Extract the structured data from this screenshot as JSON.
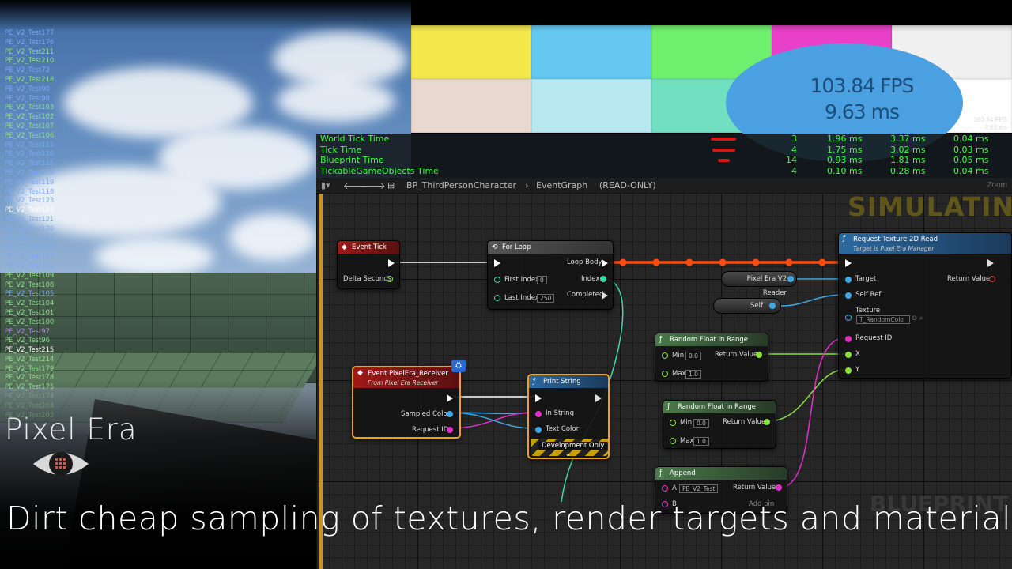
{
  "overlay": {
    "fps_value": "103.84 FPS",
    "frame_ms": "9.63 ms",
    "fps_small": "103.84 FPS",
    "ms_small": "9.63 ms"
  },
  "colors": {
    "board": [
      "#f4e84a",
      "#64c8f0",
      "#6ef06e",
      "#e840c8",
      "#f0f0f0",
      "#e8d8d0",
      "#b8e8f0",
      "#70e0c0",
      "#e8e8e8",
      "#ffffff"
    ],
    "test_green": "#8fe08f",
    "test_blue": "#7aaaf0",
    "test_purple": "#b08ae0",
    "test_white": "#ffffff",
    "accent_orange": "#c9961a",
    "exec_wire": "#ff4a10"
  },
  "tests": [
    {
      "name": "PE_V2_Test177",
      "c": "b"
    },
    {
      "name": "PE_V2_Test176",
      "c": "b"
    },
    {
      "name": "PE_V2_Test211",
      "c": "g"
    },
    {
      "name": "PE_V2_Test210",
      "c": "g"
    },
    {
      "name": "PE_V2_Test72",
      "c": "b"
    },
    {
      "name": "PE_V2_Test218",
      "c": "g"
    },
    {
      "name": "PE_V2_Test90",
      "c": "b"
    },
    {
      "name": "PE_V2_Test98",
      "c": "b"
    },
    {
      "name": "PE_V2_Test103",
      "c": "g"
    },
    {
      "name": "PE_V2_Test102",
      "c": "g"
    },
    {
      "name": "PE_V2_Test107",
      "c": "g"
    },
    {
      "name": "PE_V2_Test106",
      "c": "g"
    },
    {
      "name": "PE_V2_Test111",
      "c": "b"
    },
    {
      "name": "PE_V2_Test110",
      "c": "b"
    },
    {
      "name": "PE_V2_Test115",
      "c": "b"
    },
    {
      "name": "PE_V2_Test114",
      "c": "b"
    },
    {
      "name": "PE_V2_Test119",
      "c": "b"
    },
    {
      "name": "PE_V2_Test118",
      "c": "b"
    },
    {
      "name": "PE_V2_Test123",
      "c": "b"
    },
    {
      "name": "PE_V2_Test122",
      "c": "w"
    },
    {
      "name": "PE_V2_Test121",
      "c": "b"
    },
    {
      "name": "PE_V2_Test120",
      "c": "b"
    },
    {
      "name": "PE_V2_Test117",
      "c": "b"
    },
    {
      "name": "PE_V2_Test116",
      "c": "b"
    },
    {
      "name": "PE_V2_Test113",
      "c": "b"
    },
    {
      "name": "PE_V2_Test112",
      "c": "b"
    },
    {
      "name": "PE_V2_Test109",
      "c": "g"
    },
    {
      "name": "PE_V2_Test108",
      "c": "g"
    },
    {
      "name": "PE_V2_Test105",
      "c": "b"
    },
    {
      "name": "PE_V2_Test104",
      "c": "g"
    },
    {
      "name": "PE_V2_Test101",
      "c": "g"
    },
    {
      "name": "PE_V2_Test100",
      "c": "g"
    },
    {
      "name": "PE_V2_Test97",
      "c": "p"
    },
    {
      "name": "PE_V2_Test96",
      "c": "g"
    },
    {
      "name": "PE_V2_Test215",
      "c": "w"
    },
    {
      "name": "PE_V2_Test214",
      "c": "g"
    },
    {
      "name": "PE_V2_Test179",
      "c": "g"
    },
    {
      "name": "PE_V2_Test178",
      "c": "g"
    },
    {
      "name": "PE_V2_Test175",
      "c": "g"
    },
    {
      "name": "PE_V2_Test174",
      "c": "g"
    },
    {
      "name": "PE_V2_Test204",
      "c": "g"
    },
    {
      "name": "PE_V2_Test203",
      "c": "g"
    }
  ],
  "stats": {
    "rows": [
      {
        "name": "World Tick Time",
        "count": "3",
        "avg": "1.96 ms",
        "max": "3.37 ms",
        "min": "0.04 ms",
        "bar": 0.8
      },
      {
        "name": "Tick Time",
        "count": "4",
        "avg": "1.75 ms",
        "max": "3.02 ms",
        "min": "0.03 ms",
        "bar": 0.72
      },
      {
        "name": "Blueprint Time",
        "count": "14",
        "avg": "0.93 ms",
        "max": "1.81 ms",
        "min": "0.05 ms",
        "bar": 0.38
      },
      {
        "name": "TickableGameObjects Time",
        "count": "4",
        "avg": "0.10 ms",
        "max": "0.28 ms",
        "min": "0.04 ms",
        "bar": 0.0
      }
    ]
  },
  "blueprint": {
    "breadcrumb_class": "BP_ThirdPersonCharacter",
    "breadcrumb_graph": "EventGraph",
    "readonly": "(READ-ONLY)",
    "zoom": "Zoom",
    "simulating": "SIMULATING",
    "watermark": "BLUEPRINT",
    "nodes": {
      "event_tick": {
        "title": "Event Tick",
        "delta": "Delta Seconds"
      },
      "for_loop": {
        "title": "For Loop",
        "loop_body": "Loop Body",
        "first_index": "First Index",
        "first_val": "0",
        "index": "Index",
        "last_index": "Last Index",
        "last_val": "250",
        "completed": "Completed"
      },
      "request_texture": {
        "title": "Request Texture 2D Read",
        "subtitle": "Target is Pixel Era Manager",
        "target": "Target",
        "return_value": "Return Value",
        "self_ref": "Self Ref",
        "texture": "Texture",
        "texture_val": "T_RandomColo",
        "request_id": "Request ID",
        "x": "X",
        "y": "Y"
      },
      "reader_var": {
        "label": "Pixel Era V2 Reader"
      },
      "self_var": {
        "label": "Self"
      },
      "rand1": {
        "title": "Random Float in Range",
        "min": "Min",
        "min_val": "0.0",
        "max": "Max",
        "max_val": "1.0",
        "return_value": "Return Value"
      },
      "rand2": {
        "title": "Random Float in Range",
        "min": "Min",
        "min_val": "0.0",
        "max": "Max",
        "max_val": "1.0",
        "return_value": "Return Value"
      },
      "event_receiver": {
        "title": "Event PixelEra_Receiver",
        "subtitle": "From Pixel Era Receiver",
        "sampled_color": "Sampled Color",
        "request_id": "Request ID"
      },
      "print_string": {
        "title": "Print String",
        "in_string": "In String",
        "text_color": "Text Color",
        "dev_only": "Development Only"
      },
      "append": {
        "title": "Append",
        "a": "A",
        "a_val": "PE_V2_Test",
        "b": "B",
        "return_value": "Return Value",
        "add_pin": "Add pin"
      }
    }
  },
  "branding": {
    "logo_text": "Pixel Era",
    "tagline": "Dirt cheap sampling of textures, render targets and materials"
  }
}
